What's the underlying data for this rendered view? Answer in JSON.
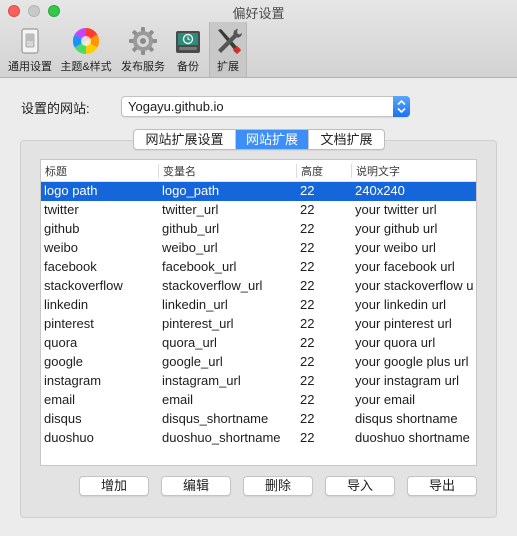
{
  "window": {
    "title": "偏好设置"
  },
  "toolbar": {
    "items": [
      {
        "label": "通用设置",
        "icon": "switch-icon"
      },
      {
        "label": "主题&样式",
        "icon": "color-wheel-icon"
      },
      {
        "label": "发布服务",
        "icon": "gear-icon"
      },
      {
        "label": "备份",
        "icon": "time-machine-icon"
      },
      {
        "label": "扩展",
        "icon": "tools-icon",
        "selected": true
      }
    ]
  },
  "site": {
    "label": "设置的网站:",
    "value": "Yogayu.github.io"
  },
  "tabs": [
    {
      "label": "网站扩展设置"
    },
    {
      "label": "网站扩展",
      "active": true
    },
    {
      "label": "文档扩展"
    }
  ],
  "table": {
    "columns": [
      "标题",
      "变量名",
      "高度",
      "说明文字"
    ],
    "rows": [
      [
        "logo path",
        "logo_path",
        "22",
        "240x240"
      ],
      [
        "twitter",
        "twitter_url",
        "22",
        "your twitter url"
      ],
      [
        "github",
        "github_url",
        "22",
        "your github url"
      ],
      [
        "weibo",
        "weibo_url",
        "22",
        "your weibo url"
      ],
      [
        "facebook",
        "facebook_url",
        "22",
        "your facebook url"
      ],
      [
        "stackoverflow",
        "stackoverflow_url",
        "22",
        "your stackoverflow url"
      ],
      [
        "linkedin",
        "linkedin_url",
        "22",
        "your linkedin url"
      ],
      [
        "pinterest",
        "pinterest_url",
        "22",
        "your pinterest url"
      ],
      [
        "quora",
        "quora_url",
        "22",
        "your quora url"
      ],
      [
        "google",
        "google_url",
        "22",
        "your google plus url"
      ],
      [
        "instagram",
        "instagram_url",
        "22",
        "your instagram url"
      ],
      [
        "email",
        "email",
        "22",
        "your email"
      ],
      [
        "disqus",
        "disqus_shortname",
        "22",
        "disqus shortname"
      ],
      [
        "duoshuo",
        "duoshuo_shortname",
        "22",
        "duoshuo shortname"
      ]
    ],
    "selected_row": 0
  },
  "buttons": {
    "add": "增加",
    "edit": "编辑",
    "delete": "删除",
    "import": "导入",
    "export": "导出"
  },
  "colors": {
    "selection": "#1566db",
    "active_tab": "#3e8ef7",
    "close": "#fc605c",
    "maximize": "#34c84a"
  }
}
